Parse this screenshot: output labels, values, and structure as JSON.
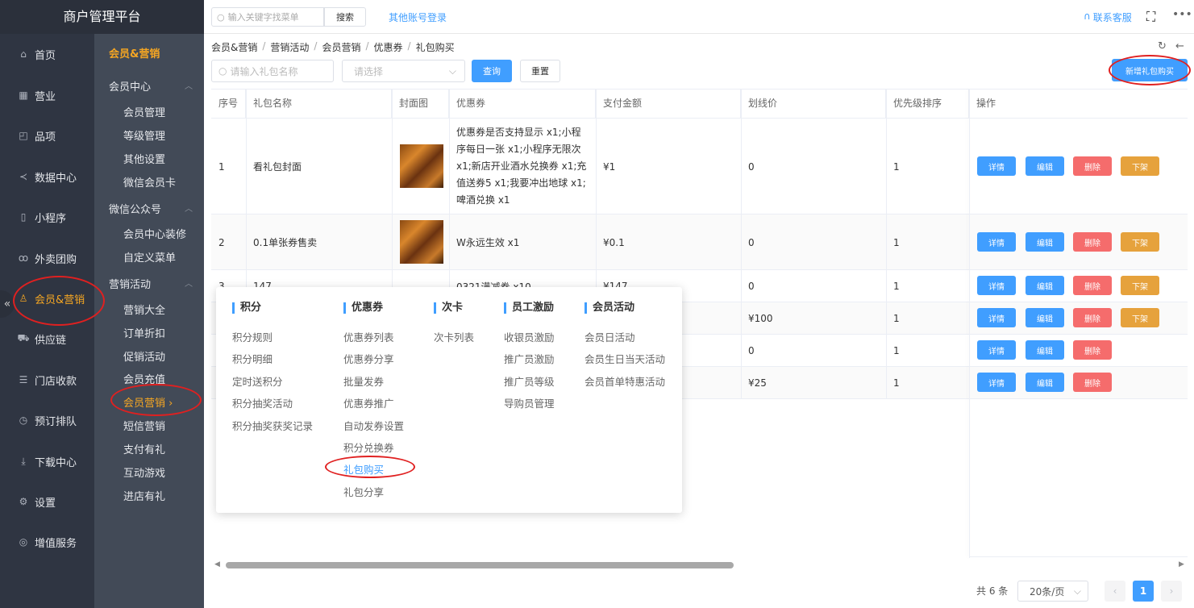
{
  "app": {
    "title": "商户管理平台"
  },
  "sidebar": {
    "items": [
      {
        "label": "首页",
        "icon": "home-icon"
      },
      {
        "label": "营业",
        "icon": "calendar-icon"
      },
      {
        "label": "品项",
        "icon": "bag-icon"
      },
      {
        "label": "数据中心",
        "icon": "share-icon"
      },
      {
        "label": "小程序",
        "icon": "phone-icon"
      },
      {
        "label": "外卖团购",
        "icon": "bike-icon"
      },
      {
        "label": "会员&营销",
        "icon": "user-icon"
      },
      {
        "label": "供应链",
        "icon": "truck-icon"
      },
      {
        "label": "门店收款",
        "icon": "database-icon"
      },
      {
        "label": "预订排队",
        "icon": "clock-icon"
      },
      {
        "label": "下载中心",
        "icon": "download-icon"
      },
      {
        "label": "设置",
        "icon": "gear-icon"
      },
      {
        "label": "增值服务",
        "icon": "alarm-icon"
      }
    ],
    "active": "会员&营销",
    "collapse_glyph": "«"
  },
  "subnav": {
    "heading": "会员&营销",
    "groups": [
      {
        "label": "会员中心",
        "items": [
          "会员管理",
          "等级管理",
          "其他设置",
          "微信会员卡"
        ]
      },
      {
        "label": "微信公众号",
        "items": [
          "会员中心装修",
          "自定义菜单"
        ]
      },
      {
        "label": "营销活动",
        "items": [
          "营销大全",
          "订单折扣",
          "促销活动",
          "会员充值",
          "会员营销 ›",
          "短信营销",
          "支付有礼",
          "互动游戏",
          "进店有礼"
        ]
      }
    ]
  },
  "topbar": {
    "search_placeholder": "输入关键字找菜单",
    "search_button": "搜索",
    "other_login": "其他账号登录",
    "contact": "联系客服",
    "more": "•••"
  },
  "breadcrumb": [
    "会员&营销",
    "营销活动",
    "会员营销",
    "优惠券",
    "礼包购买"
  ],
  "filter": {
    "name_placeholder": "请输入礼包名称",
    "select_placeholder": "请选择",
    "query": "查询",
    "reset": "重置",
    "add": "新增礼包购买"
  },
  "table": {
    "columns": [
      "序号",
      "礼包名称",
      "封面图",
      "优惠券",
      "支付金额",
      "划线价",
      "优先级排序",
      "操作"
    ],
    "rows": [
      {
        "no": "1",
        "name": "看礼包封面",
        "coupon": "优惠券是否支持显示 x1;小程序每日一张 x1;小程序无限次 x1;新店开业酒水兑换券 x1;充值送券5 x1;我要冲出地球 x1;啤酒兑换 x1",
        "pay": "¥1",
        "strike": "0",
        "priority": "1",
        "actions": [
          "详情",
          "编辑",
          "删除",
          "下架"
        ]
      },
      {
        "no": "2",
        "name": "0.1单张券售卖",
        "coupon": "W永远生效 x1",
        "pay": "¥0.1",
        "strike": "0",
        "priority": "1",
        "actions": [
          "详情",
          "编辑",
          "删除",
          "下架"
        ]
      },
      {
        "no": "3",
        "name": "147",
        "coupon": "0321满减券 x10",
        "pay": "¥147",
        "strike": "0",
        "priority": "1",
        "actions": [
          "详情",
          "编辑",
          "删除",
          "下架"
        ]
      },
      {
        "no": "",
        "name": "",
        "coupon": "",
        "pay": "",
        "strike": "¥100",
        "priority": "1",
        "actions": [
          "详情",
          "编辑",
          "删除",
          "下架"
        ]
      },
      {
        "no": "",
        "name": "",
        "coupon": "",
        "pay": "",
        "strike": "0",
        "priority": "1",
        "actions": [
          "详情",
          "编辑",
          "删除"
        ]
      },
      {
        "no": "",
        "name": "",
        "coupon": "",
        "pay": "",
        "strike": "¥25",
        "priority": "1",
        "actions": [
          "详情",
          "编辑",
          "删除"
        ]
      }
    ]
  },
  "popup": {
    "categories": [
      {
        "title": "积分",
        "items": [
          "积分规则",
          "积分明细",
          "定时送积分",
          "积分抽奖活动",
          "积分抽奖获奖记录"
        ]
      },
      {
        "title": "优惠券",
        "items": [
          "优惠券列表",
          "优惠券分享",
          "批量发券",
          "优惠券推广",
          "自动发券设置",
          "积分兑换券",
          "礼包购买",
          "礼包分享"
        ]
      },
      {
        "title": "次卡",
        "items": [
          "次卡列表"
        ]
      },
      {
        "title": "员工激励",
        "items": [
          "收银员激励",
          "推广员激励",
          "推广员等级",
          "导购员管理"
        ]
      },
      {
        "title": "会员活动",
        "items": [
          "会员日活动",
          "会员生日当天活动",
          "会员首单特惠活动"
        ]
      }
    ],
    "current": "礼包购买"
  },
  "pagination": {
    "total": "共 6 条",
    "page_size": "20条/页",
    "current_page": "1",
    "prev": "‹",
    "next": "›"
  },
  "colors": {
    "primary": "#409eff",
    "danger": "#f56c6c",
    "warning": "#e6a23c",
    "accent": "#f5a623",
    "sidebar": "#2f3542"
  }
}
